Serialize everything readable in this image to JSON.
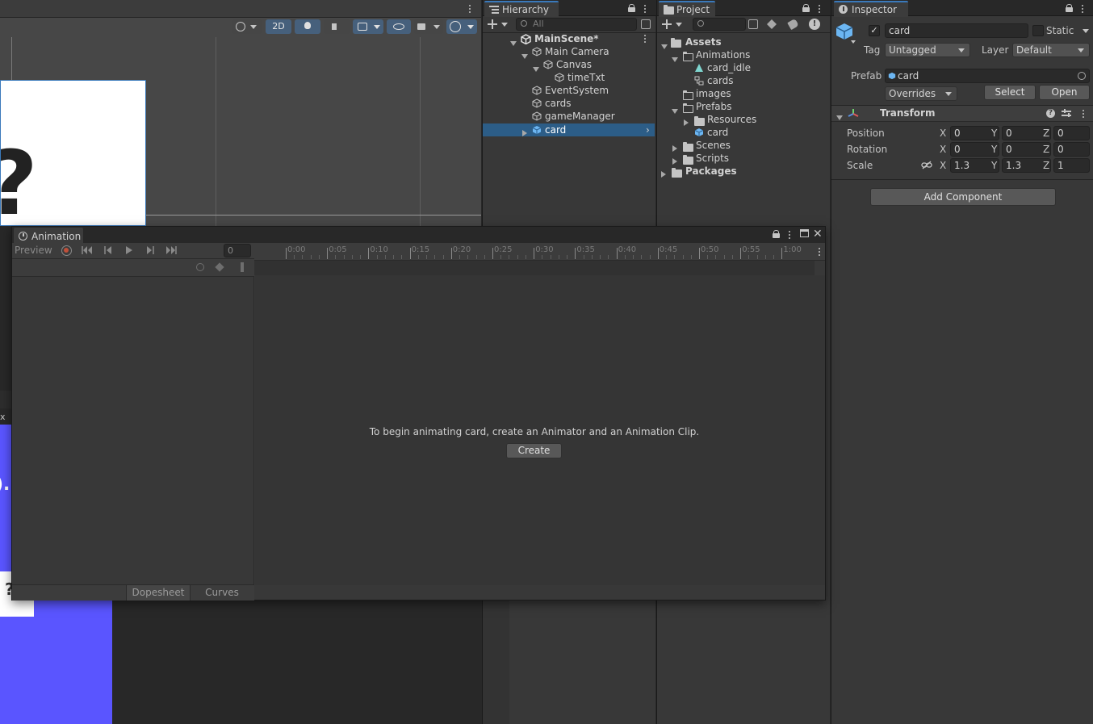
{
  "scene_toolbar": {
    "button_2d": "2D"
  },
  "game_view": {
    "question_mark": "?",
    "partial_text": ")."
  },
  "hierarchy": {
    "tab": "Hierarchy",
    "search_placeholder": "All",
    "scene_name": "MainScene*",
    "items": [
      {
        "label": "Main Camera"
      },
      {
        "label": "Canvas"
      },
      {
        "label": "timeTxt"
      },
      {
        "label": "EventSystem"
      },
      {
        "label": "cards"
      },
      {
        "label": "gameManager"
      },
      {
        "label": "card"
      }
    ]
  },
  "project": {
    "tab": "Project",
    "items": [
      {
        "label": "Assets"
      },
      {
        "label": "Animations"
      },
      {
        "label": "card_idle"
      },
      {
        "label": "cards"
      },
      {
        "label": "images"
      },
      {
        "label": "Prefabs"
      },
      {
        "label": "Resources"
      },
      {
        "label": "card"
      },
      {
        "label": "Scenes"
      },
      {
        "label": "Scripts"
      },
      {
        "label": "Packages"
      }
    ]
  },
  "inspector": {
    "tab": "Inspector",
    "object_name": "card",
    "static_label": "Static",
    "tag_label": "Tag",
    "tag_value": "Untagged",
    "layer_label": "Layer",
    "layer_value": "Default",
    "prefab_label": "Prefab",
    "prefab_value": "card",
    "overrides": "Overrides",
    "select": "Select",
    "open": "Open",
    "transform_title": "Transform",
    "position_label": "Position",
    "rotation_label": "Rotation",
    "scale_label": "Scale",
    "x": "X",
    "y": "Y",
    "z": "Z",
    "position": [
      "0",
      "0",
      "0"
    ],
    "rotation": [
      "0",
      "0",
      "0"
    ],
    "scale": [
      "1.3",
      "1.3",
      "1"
    ],
    "add_component": "Add Component"
  },
  "animation": {
    "tab": "Animation",
    "preview": "Preview",
    "frame": "0",
    "timeline_ticks": [
      "0:00",
      "0:05",
      "0:10",
      "0:15",
      "0:20",
      "0:25",
      "0:30",
      "0:35",
      "0:40",
      "0:45",
      "0:50",
      "0:55",
      "1:00"
    ],
    "message": "To begin animating card, create an Animator and an Animation Clip.",
    "create": "Create",
    "dopesheet": "Dopesheet",
    "curves": "Curves"
  },
  "colors": {
    "accent": "#3a79bb",
    "selection": "#2c5d87",
    "game_bg": "#5a55ff",
    "record": "#c0503a"
  }
}
